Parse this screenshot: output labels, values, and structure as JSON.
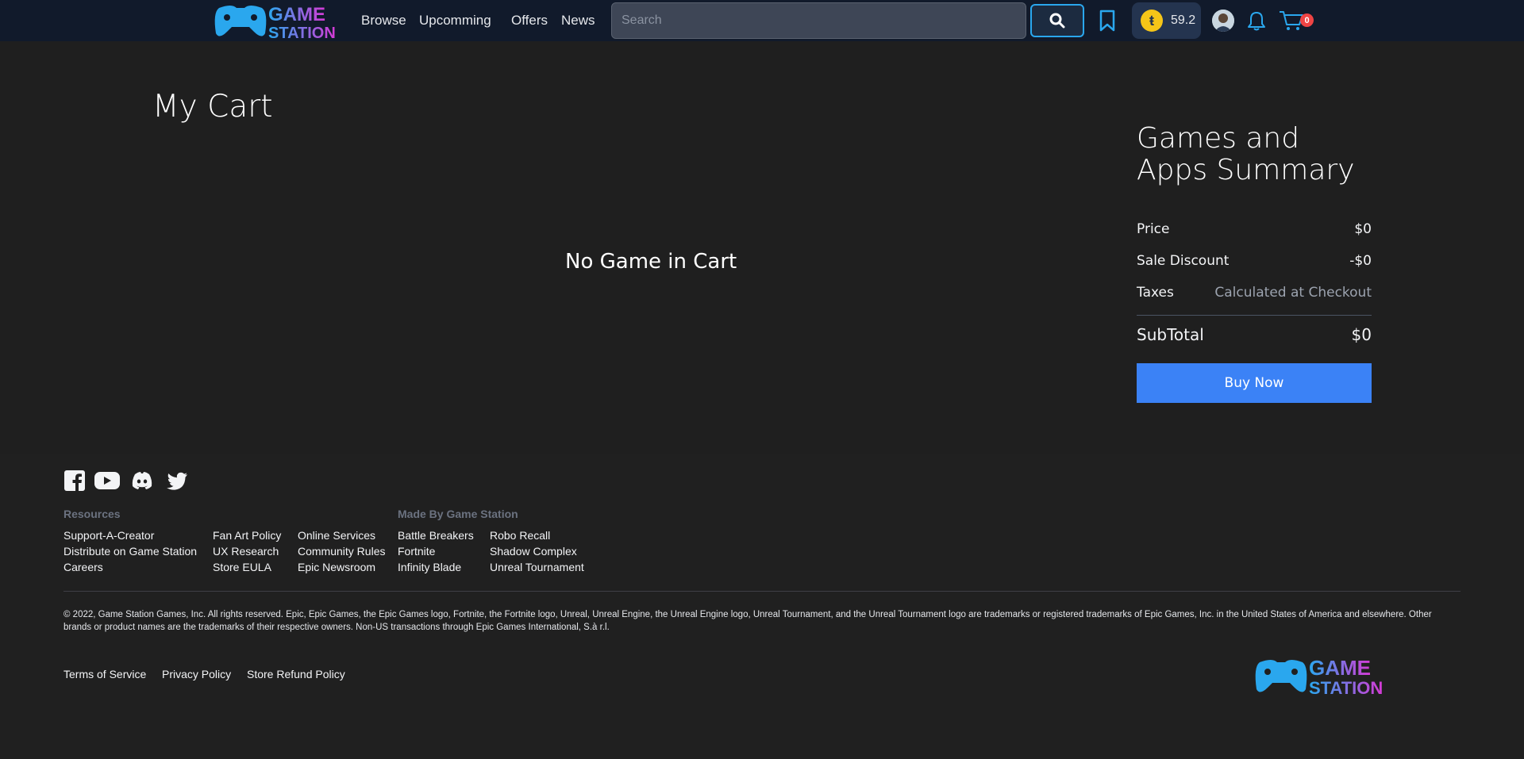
{
  "header": {
    "logo_line1": "GAME",
    "logo_line2": "STATION",
    "nav": [
      "Browse",
      "Upcomming",
      "Offers",
      "News"
    ],
    "search_placeholder": "Search",
    "coins": "59.2",
    "cart_count": "0",
    "icons": [
      "controller-logo-icon",
      "search-icon",
      "bookmark-icon",
      "coin-icon",
      "avatar",
      "bell-icon",
      "cart-icon"
    ]
  },
  "main": {
    "title": "My Cart",
    "empty_message": "No Game in Cart"
  },
  "summary": {
    "title_line1": "Games and",
    "title_line2": "Apps Summary",
    "rows": [
      {
        "label": "Price",
        "value": "$0"
      },
      {
        "label": "Sale Discount",
        "value": "-$0"
      },
      {
        "label": "Taxes",
        "value": "Calculated at Checkout"
      }
    ],
    "subtotal_label": "SubTotal",
    "subtotal_value": "$0",
    "buy_label": "Buy Now"
  },
  "footer": {
    "resources_heading": "Resources",
    "made_by_heading": "Made By Game Station",
    "col1": [
      "Support-A-Creator",
      "Distribute on Game Station",
      "Careers"
    ],
    "col2": [
      "Fan Art Policy",
      "UX Research",
      "Store EULA"
    ],
    "col3": [
      "Online Services",
      "Community Rules",
      "Epic Newsroom"
    ],
    "col4": [
      "Battle Breakers",
      "Fortnite",
      "Infinity Blade"
    ],
    "col5": [
      "Robo Recall",
      "Shadow Complex",
      "Unreal Tournament"
    ],
    "legal": "© 2022, Game Station Games, Inc. All rights reserved. Epic, Epic Games, the Epic Games logo, Fortnite, the Fortnite logo, Unreal, Unreal Engine, the Unreal Engine logo, Unreal Tournament, and the Unreal Tournament logo are trademarks or registered trademarks of Epic Games, Inc. in the United States of America and elsewhere. Other brands or product names are the trademarks of their respective owners. Non-US transactions through Epic Games International, S.à r.l.",
    "bottom_links": [
      "Terms of Service",
      "Privacy Policy",
      "Store Refund Policy"
    ],
    "social_icons": [
      "facebook-icon",
      "youtube-icon",
      "discord-icon",
      "twitter-icon"
    ]
  },
  "colors": {
    "header_bg": "#111a2b",
    "page_bg": "#1f1f1f",
    "accent_blue": "#3b82f6",
    "logo_cyan": "#2aa7ee",
    "logo_magenta": "#d63ad6",
    "badge_red": "#ef4444",
    "coin_yellow": "#f5c518"
  }
}
